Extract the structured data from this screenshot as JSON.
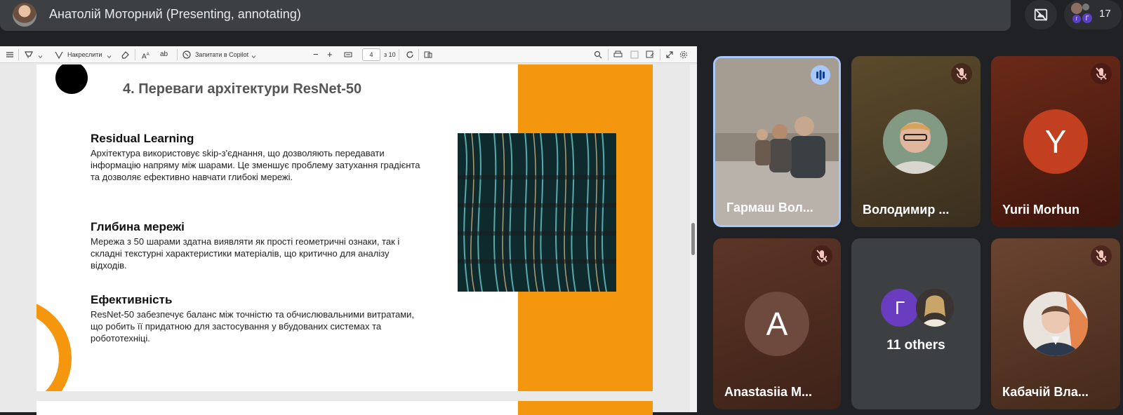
{
  "topbar": {
    "presenter_name": "Анатолій Моторний (Presenting, annotating)",
    "participants_count": "17",
    "mini_avatars": [
      "г",
      "Г"
    ]
  },
  "pdf_toolbar": {
    "draw_label": "Накреслити",
    "copilot_label": "Запитати в Copilot",
    "current_page": "4",
    "total_pages_label": "з 10",
    "icons": [
      "contents-icon",
      "highlight-icon",
      "draw-icon",
      "eraser-icon",
      "text-size-icon",
      "translate-icon",
      "copilot-icon",
      "zoom-out-icon",
      "zoom-in-icon",
      "fit-page-icon",
      "rotate-icon",
      "page-view-icon",
      "search-icon",
      "print-icon",
      "save-icon",
      "save-as-icon",
      "fullscreen-icon",
      "settings-icon"
    ]
  },
  "slide": {
    "title": "4. Переваги архітектури ResNet-50",
    "sections": [
      {
        "heading": "Residual Learning",
        "body": "Архітектура використовує skip-з'єднання, що дозволяють передавати інформацію напряму між шарами. Це зменшує проблему затухання градієнта та дозволяє ефективно навчати глибокі мережі."
      },
      {
        "heading": "Глибина мережі",
        "body": "Мережа з 50 шарами здатна виявляти як прості геометричні ознаки, так і складні текстурні характеристики матеріалів, що критично для аналізу відходів."
      },
      {
        "heading": "Ефективність",
        "body": "ResNet-50 забезпечує баланс між точністю та обчислювальними витратами, що робить її придатною для застосування у вбудованих системах та робототехніці."
      }
    ],
    "accent_color": "#f4960e"
  },
  "participants": [
    {
      "name": "Гармаш Вол...",
      "type": "video",
      "speaking": true
    },
    {
      "name": "Володимир ...",
      "type": "photo",
      "muted": true,
      "bg": "#4a3b22"
    },
    {
      "name": "Yurii Morhun",
      "type": "letter",
      "letter": "Y",
      "muted": true,
      "bg": "#5a2012",
      "avatar_color": "#c2401f"
    },
    {
      "name": "Anastasiia M...",
      "type": "letter",
      "letter": "A",
      "muted": true,
      "bg": "#4e2e22",
      "avatar_color": "#6e4a3e"
    },
    {
      "name": "11 others",
      "type": "others",
      "letter": "Г",
      "bg": "#3c4043",
      "avatar_color": "#6a3cc0"
    },
    {
      "name": "Кабачій Вла...",
      "type": "photo",
      "muted": true,
      "bg": "#5a3a26"
    }
  ]
}
